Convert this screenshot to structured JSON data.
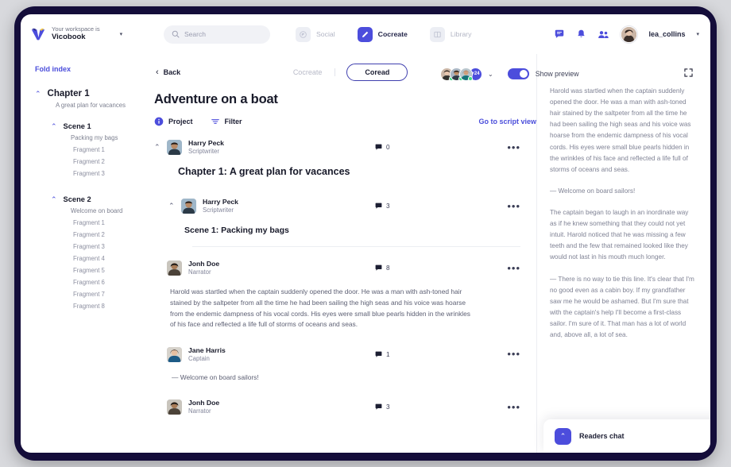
{
  "topbar": {
    "workspace_prefix": "Your workspace is",
    "workspace_name": "Vicobook",
    "workspace_caret": "▾",
    "search_placeholder": "Search",
    "nav": [
      {
        "label": "Social",
        "icon": "social-icon",
        "active": false
      },
      {
        "label": "Cocreate",
        "icon": "pencil-icon",
        "active": true
      },
      {
        "label": "Library",
        "icon": "book-icon",
        "active": false
      }
    ],
    "user_name": "lea_collins",
    "user_caret": "▾"
  },
  "sidebar": {
    "fold_index": "Fold index",
    "chapter": {
      "title": "Chapter 1",
      "subtitle": "A great plan for vacances",
      "chevron": "⌃"
    },
    "scenes": [
      {
        "title": "Scene 1",
        "subtitle": "Packing my bags",
        "chevron": "⌃",
        "fragments": [
          "Fragment 1",
          "Fragment 2",
          "Fragment 3"
        ]
      },
      {
        "title": "Scene 2",
        "subtitle": "Welcome on board",
        "chevron": "⌃",
        "fragments": [
          "Fragment 1",
          "Fragment 2",
          "Fragment 3",
          "Fragment 4",
          "Fragment 5",
          "Fragment 6",
          "Fragment 7",
          "Fragment 8"
        ]
      }
    ]
  },
  "main": {
    "back_label": "Back",
    "back_chevron": "‹",
    "mode_inactive": "Cocreate",
    "mode_active": "Coread",
    "doc_title": "Adventure on a boat",
    "toolbar": {
      "project_label": "Project",
      "filter_label": "Filter",
      "script_link": "Go to script view",
      "avatars_more": "+24",
      "avatars_caret": "⌄",
      "toggle_label": "Show preview",
      "toggle_on": true,
      "expand_icon": "expand-icon"
    },
    "posts": [
      {
        "author": "Harry Peck",
        "role": "Scriptwriter",
        "comments": "0",
        "chevron": "⌃",
        "heading_level": "h1",
        "heading": "Chapter 1: A great plan for vacances",
        "body": "",
        "avatar_kind": "harry"
      },
      {
        "author": "Harry Peck",
        "role": "Scriptwriter",
        "comments": "3",
        "chevron": "⌃",
        "heading_level": "h2",
        "heading": "Scene 1: Packing my bags",
        "body": "",
        "avatar_kind": "harry"
      },
      {
        "author": "Jonh Doe",
        "role": "Narrator",
        "comments": "8",
        "chevron": "",
        "heading_level": "",
        "heading": "",
        "body": "Harold was startled when the captain suddenly opened the door. He was a man with ash-toned hair stained by the saltpeter from all the time he had been sailing the high seas and his voice was hoarse from the endemic dampness of his vocal cords. His eyes were small blue pearls hidden in the wrinkles of his face and reflected a life full of storms of oceans and seas.",
        "avatar_kind": "jonh"
      },
      {
        "author": "Jane Harris",
        "role": "Captain",
        "comments": "1",
        "chevron": "",
        "heading_level": "",
        "heading": "",
        "body": "— Welcome on board sailors!",
        "avatar_kind": "jane"
      },
      {
        "author": "Jonh Doe",
        "role": "Narrator",
        "comments": "3",
        "chevron": "",
        "heading_level": "",
        "heading": "",
        "body": "",
        "avatar_kind": "jonh"
      }
    ]
  },
  "preview": {
    "paragraphs": [
      "Harold was startled when the captain suddenly opened the door. He was a man with ash-toned hair stained by the saltpeter from all the time he had been sailing the high seas and his voice was hoarse from the endemic dampness of his vocal cords. His eyes were small blue pearls hidden in the wrinkles of his face and reflected a life full of storms of oceans and seas.",
      "— Welcome on board sailors!",
      "The captain began to laugh in an inordinate way as if he knew something that they could not yet intuit. Harold noticed that he was missing a few teeth and the few that remained looked like they would not last in his mouth much longer.",
      "— There is no way to tie this line. It's clear that I'm no good even as a cabin boy. If my grandfather saw me he would be ashamed. But I'm sure that with the captain's help I'll become a first-class sailor. I'm sure of it. That man has a lot of world and, above all, a lot of sea."
    ],
    "readers_chat_label": "Readers chat",
    "readers_chat_chevron": "⌃"
  },
  "colors": {
    "accent": "#4c4ddc",
    "accent_link": "#4a4ddb",
    "bezel": "#140d3a",
    "page_bg": "#d8d9dd",
    "text_dark": "#181a2a",
    "text_muted": "#7f8294",
    "online": "#3ddc84"
  }
}
